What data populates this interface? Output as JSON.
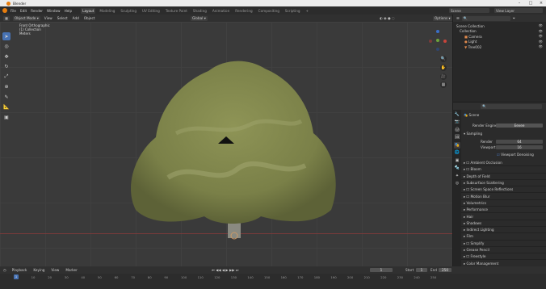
{
  "window": {
    "title": "Blender",
    "controls": [
      "minimize-icon",
      "maximize-icon",
      "close-icon"
    ]
  },
  "topbar": {
    "menus": [
      "File",
      "Edit",
      "Render",
      "Window",
      "Help"
    ],
    "workspaces": [
      "Layout",
      "Modeling",
      "Sculpting",
      "UV Editing",
      "Texture Paint",
      "Shading",
      "Animation",
      "Rendering",
      "Compositing",
      "Scripting"
    ],
    "active_workspace": "Layout",
    "scene_label": "Scene",
    "view_layer_label": "View Layer"
  },
  "viewport_header": {
    "mode": "Object Mode",
    "menus": [
      "View",
      "Select",
      "Add",
      "Object"
    ],
    "transform": "Global",
    "options": "Options"
  },
  "viewport": {
    "info_line1": "Front Orthographic",
    "info_line2": "(1) Collection",
    "info_line3": "Meters"
  },
  "outliner": {
    "search_placeholder": "",
    "rows": [
      {
        "label": "Scene Collection",
        "indent": 0
      },
      {
        "label": "Collection",
        "indent": 1
      },
      {
        "label": "Camera",
        "indent": 2
      },
      {
        "label": "Light",
        "indent": 2
      },
      {
        "label": "Tree002",
        "indent": 2
      }
    ]
  },
  "properties": {
    "header": "Scene",
    "render_engine_label": "Render Engine",
    "render_engine_value": "Eevee",
    "sampling": "Sampling",
    "render_label": "Render",
    "render_value": "64",
    "viewport_label": "Viewport",
    "viewport_value": "16",
    "viewport_denoising": "Viewport Denoising",
    "panels": [
      "Ambient Occlusion",
      "Bloom",
      "Depth of Field",
      "Subsurface Scattering",
      "Screen Space Reflections",
      "Motion Blur",
      "Volumetrics",
      "Performance",
      "Hair",
      "Shadows",
      "Indirect Lighting",
      "Film",
      "Simplify",
      "Grease Pencil",
      "Freestyle",
      "Color Management"
    ]
  },
  "timeline": {
    "menus": [
      "Playback",
      "Keying",
      "View",
      "Marker"
    ],
    "current_frame": "1",
    "start_label": "Start",
    "start_value": "1",
    "end_label": "End",
    "end_value": "250",
    "ticks": [
      "0",
      "10",
      "20",
      "30",
      "40",
      "50",
      "60",
      "70",
      "80",
      "90",
      "100",
      "110",
      "120",
      "130",
      "140",
      "150",
      "160",
      "170",
      "180",
      "190",
      "200",
      "210",
      "220",
      "230",
      "240",
      "250"
    ]
  },
  "colors": {
    "accent": "#4772b3",
    "logo": "#e87d0d",
    "x_axis": "#c8443b",
    "y_axis": "#6ea33a",
    "z_axis": "#3b6fc8"
  }
}
